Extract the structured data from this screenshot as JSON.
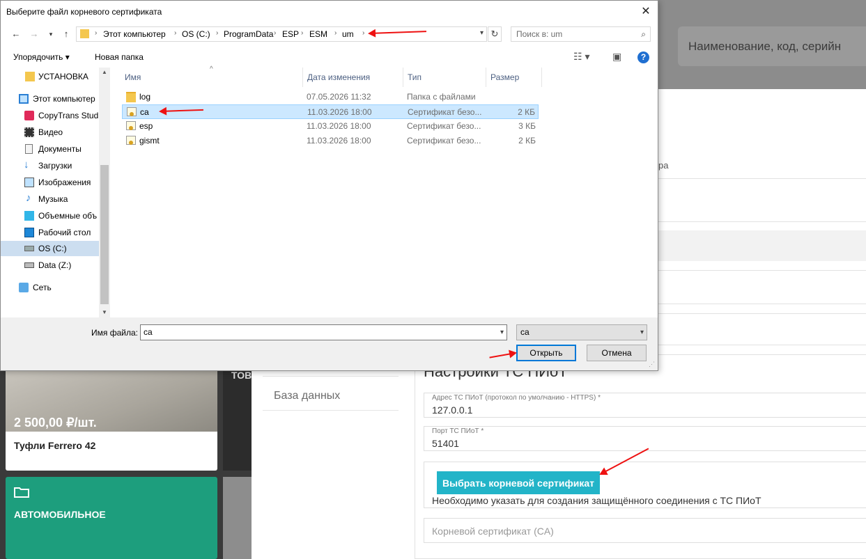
{
  "web": {
    "search_placeholder": "Наименование, код, серийн",
    "stray_text": "ра",
    "menu_item": "База данных",
    "settings_title": "Настройки ТС ПИоТ",
    "address_label": "Адрес ТС ПИоТ (протокол по умолчанию - HTTPS) *",
    "address_value": "127.0.0.1",
    "port_label": "Порт ТС ПИоТ *",
    "port_value": "51401",
    "cert_button": "Выбрать корневой сертификат",
    "cert_hint": "Необходимо указать для создания защищённого соединения с ТС ПИоТ",
    "cert_field_placeholder": "Корневой сертификат (CA)",
    "tiles": {
      "price": "2 500,00 ₽/шт.",
      "product": "Туфли Ferrero 42",
      "partial": "ТОВ",
      "category": "АВТОМОБИЛЬНОЕ"
    }
  },
  "dialog": {
    "title": "Выберите файл корневого сертификата",
    "close": "✕",
    "breadcrumbs": [
      "Этот компьютер",
      "OS (C:)",
      "ProgramData",
      "ESP",
      "ESM",
      "um"
    ],
    "search_placeholder": "Поиск в: um",
    "organize": "Упорядочить ▾",
    "new_folder": "Новая папка",
    "help": "?",
    "nav_items": [
      {
        "label": "УСТАНОВКА",
        "icon": "folder-icon"
      },
      {
        "label": "Этот компьютер",
        "icon": "computer-icon"
      },
      {
        "label": "CopyTrans Studi",
        "icon": "copytrans-icon"
      },
      {
        "label": "Видео",
        "icon": "video-icon"
      },
      {
        "label": "Документы",
        "icon": "documents-icon"
      },
      {
        "label": "Загрузки",
        "icon": "downloads-icon"
      },
      {
        "label": "Изображения",
        "icon": "pictures-icon"
      },
      {
        "label": "Музыка",
        "icon": "music-icon"
      },
      {
        "label": "Объемные объ",
        "icon": "3d-objects-icon"
      },
      {
        "label": "Рабочий стол",
        "icon": "desktop-icon"
      },
      {
        "label": "OS (C:)",
        "icon": "drive-icon"
      },
      {
        "label": "Data (Z:)",
        "icon": "network-drive-icon"
      },
      {
        "label": "Сеть",
        "icon": "network-icon"
      }
    ],
    "columns": [
      "Имя",
      "Дата изменения",
      "Тип",
      "Размер"
    ],
    "files": [
      {
        "name": "log",
        "date": "07.05.2026 11:32",
        "type": "Папка с файлами",
        "size": ""
      },
      {
        "name": "ca",
        "date": "11.03.2026 18:00",
        "type": "Сертификат безо...",
        "size": "2 КБ"
      },
      {
        "name": "esp",
        "date": "11.03.2026 18:00",
        "type": "Сертификат безо...",
        "size": "3 КБ"
      },
      {
        "name": "gismt",
        "date": "11.03.2026 18:00",
        "type": "Сертификат безо...",
        "size": "2 КБ"
      }
    ],
    "filename_label": "Имя файла:",
    "filename_value": "ca",
    "filetype_value": "ca",
    "open_button": "Открыть",
    "cancel_button": "Отмена"
  }
}
